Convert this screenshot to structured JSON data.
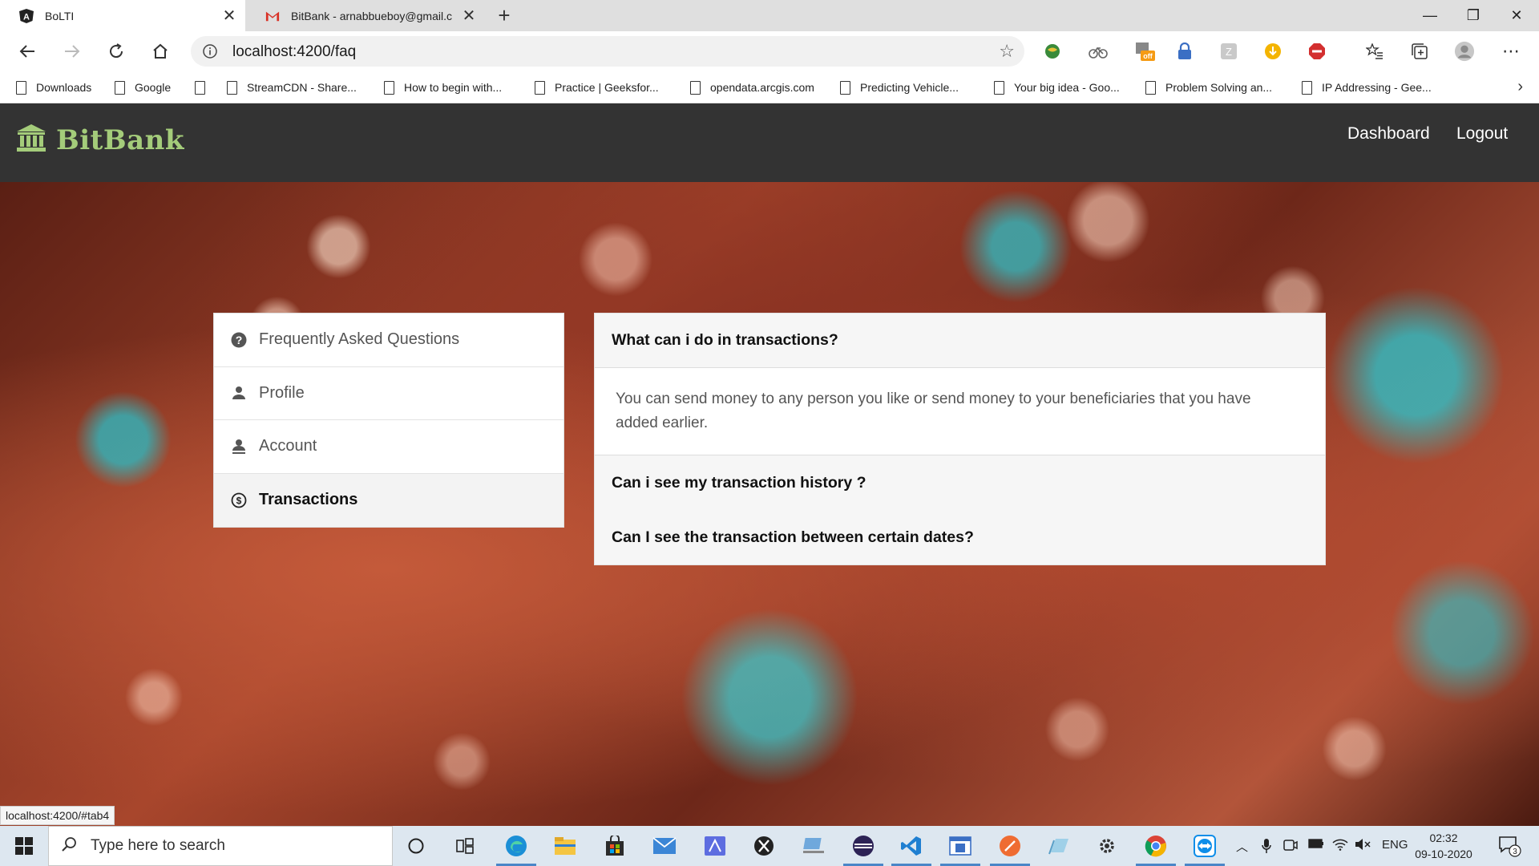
{
  "browser": {
    "tabs": [
      {
        "title": "BoLTI",
        "active": true
      },
      {
        "title": "BitBank - arnabbueboy@gmail.c",
        "active": false
      }
    ],
    "url": "localhost:4200/faq",
    "bookmarks": [
      "Downloads",
      "Google",
      "",
      "StreamCDN - Share...",
      "How to begin with...",
      "Practice | Geeksfor...",
      "opendata.arcgis.com",
      "Predicting Vehicle...",
      "Your big idea - Goo...",
      "Problem Solving an...",
      "IP Addressing - Gee..."
    ],
    "status_url": "localhost:4200/#tab4",
    "ext_badge": "off"
  },
  "app": {
    "brand": "BitBank",
    "nav": {
      "dashboard": "Dashboard",
      "logout": "Logout"
    },
    "sidebar": [
      {
        "label": "Frequently Asked Questions",
        "icon": "question-circle-icon",
        "active": false
      },
      {
        "label": "Profile",
        "icon": "person-icon",
        "active": false
      },
      {
        "label": "Account",
        "icon": "person-account-icon",
        "active": false
      },
      {
        "label": "Transactions",
        "icon": "dollar-circle-icon",
        "active": true
      }
    ],
    "faq": [
      {
        "question": "What can i do in transactions?",
        "answer": "You can send money to any person you like or send money to your beneficiaries that you have added earlier.",
        "open": true
      },
      {
        "question": "Can i see my transaction history ?",
        "open": false
      },
      {
        "question": "Can I see the transaction between certain dates?",
        "open": false
      }
    ]
  },
  "taskbar": {
    "search_placeholder": "Type here to search",
    "language": "ENG",
    "time": "02:32",
    "date": "09-10-2020",
    "notifications": "3"
  },
  "colors": {
    "nav_bg": "#333333",
    "brand": "#a4cc7a"
  }
}
